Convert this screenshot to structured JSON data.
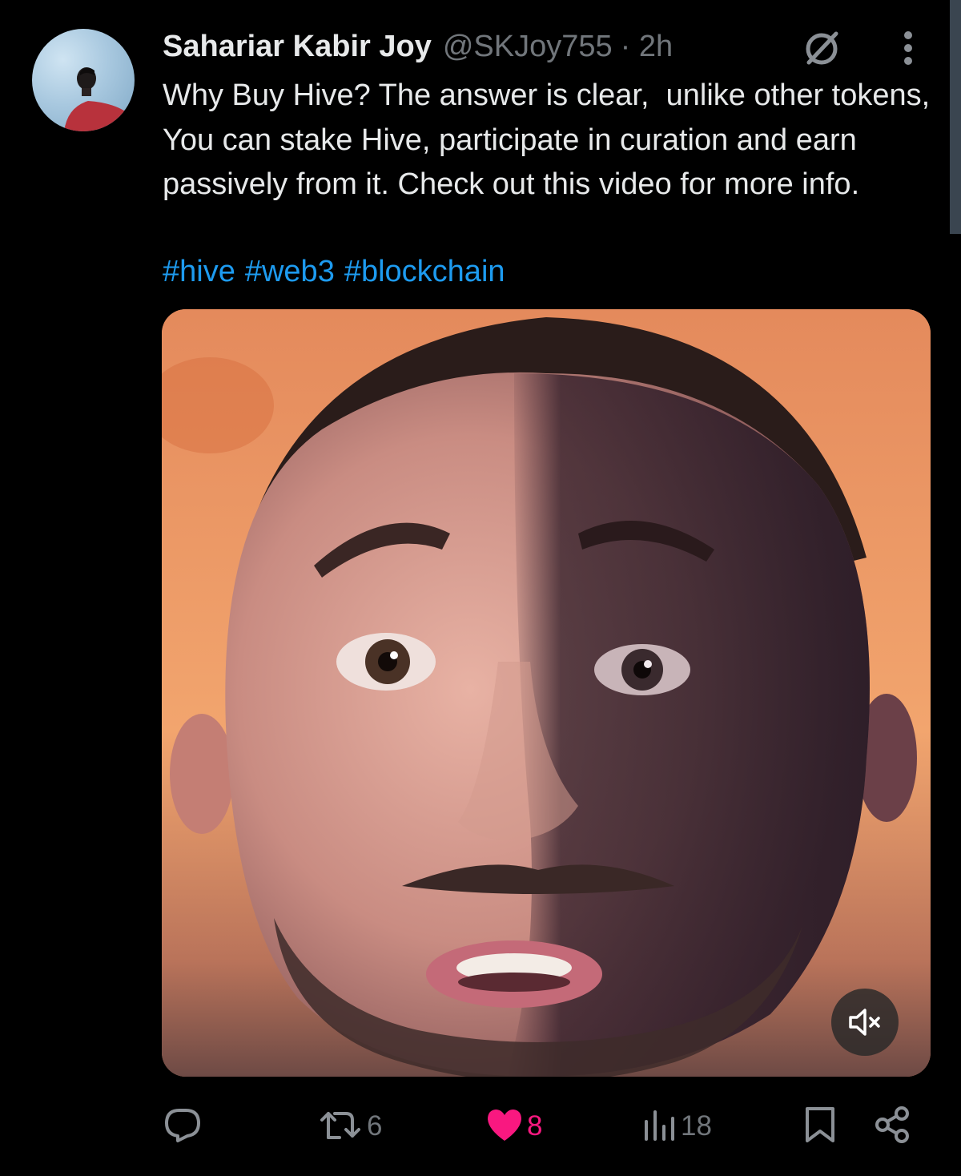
{
  "author": {
    "name": "Sahariar Kabir Joy",
    "handle": "@SKJoy755",
    "time": "· 2h"
  },
  "tweet": {
    "text": "Why Buy Hive? The answer is clear,  unlike other tokens, You can stake Hive, participate in curation and earn passively from it. Check out this video for more info.",
    "hashtags": [
      "#hive",
      "#web3",
      "#blockchain"
    ]
  },
  "media": {
    "type": "video",
    "muted": true
  },
  "actions": {
    "reposts": "6",
    "likes": "8",
    "views": "18"
  },
  "colors": {
    "background": "#000000",
    "text": "#e7e9ea",
    "secondary": "#71767b",
    "link": "#1d9bf0",
    "like": "#f91880"
  },
  "icons": [
    "grok-icon",
    "more-icon",
    "reply-icon",
    "repost-icon",
    "heart-icon",
    "views-icon",
    "bookmark-icon",
    "share-icon",
    "mute-icon"
  ]
}
